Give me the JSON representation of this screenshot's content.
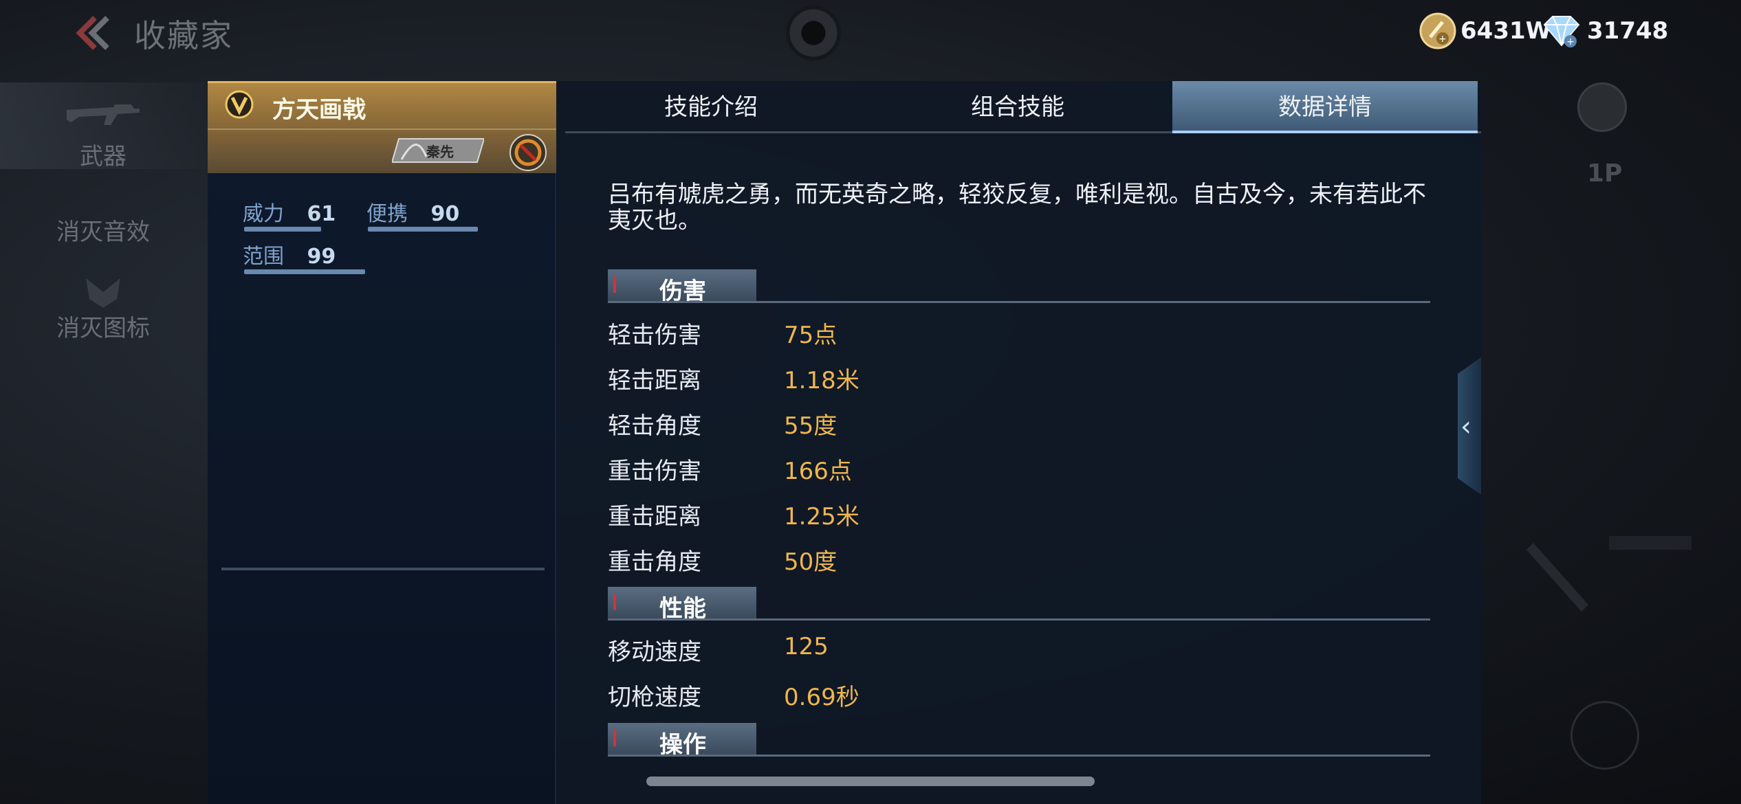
{
  "header": {
    "title": "收藏家",
    "back_icon": "chevron-left-icon"
  },
  "currency": {
    "gold": {
      "icon": "gold-coin-icon",
      "value": "6431W"
    },
    "diamond": {
      "icon": "diamond-icon",
      "value": "31748"
    }
  },
  "left_nav": {
    "items": [
      {
        "label": "武器",
        "icon": "rifle-icon",
        "active": true
      },
      {
        "label": "消灭音效",
        "icon": "sound-icon",
        "active": false
      },
      {
        "label": "消灭图标",
        "icon": "emblem-icon",
        "active": false
      }
    ]
  },
  "right_side": {
    "player_label": "1P",
    "gamepad_icon": "gamepad-icon"
  },
  "weapon": {
    "name": "方天画戟",
    "rank_icon": "v-rank-icon",
    "hero_tag": "秦先",
    "stats": [
      {
        "label": "威力",
        "value": "61"
      },
      {
        "label": "便携",
        "value": "90"
      },
      {
        "label": "范围",
        "value": "99"
      }
    ]
  },
  "tabs": [
    {
      "label": "技能介绍",
      "active": false
    },
    {
      "label": "组合技能",
      "active": false
    },
    {
      "label": "数据详情",
      "active": true
    }
  ],
  "description": "吕布有虓虎之勇，而无英奇之略，轻狡反复，唯利是视。自古及今，未有若此不夷灭也。",
  "sections": {
    "damage": {
      "title": "伤害",
      "rows": [
        {
          "key": "轻击伤害",
          "value": "75点"
        },
        {
          "key": "轻击距离",
          "value": "1.18米"
        },
        {
          "key": "轻击角度",
          "value": "55度"
        },
        {
          "key": "重击伤害",
          "value": "166点"
        },
        {
          "key": "重击距离",
          "value": "1.25米"
        },
        {
          "key": "重击角度",
          "value": "50度"
        }
      ]
    },
    "performance": {
      "title": "性能",
      "rows": [
        {
          "key": "移动速度",
          "value": "125"
        },
        {
          "key": "切枪速度",
          "value": "0.69秒"
        }
      ]
    },
    "operation": {
      "title": "操作"
    }
  },
  "colors": {
    "accent_gold": "#f0b64c",
    "tab_active": "#4f6d8c",
    "header_gold": "#b08844"
  }
}
